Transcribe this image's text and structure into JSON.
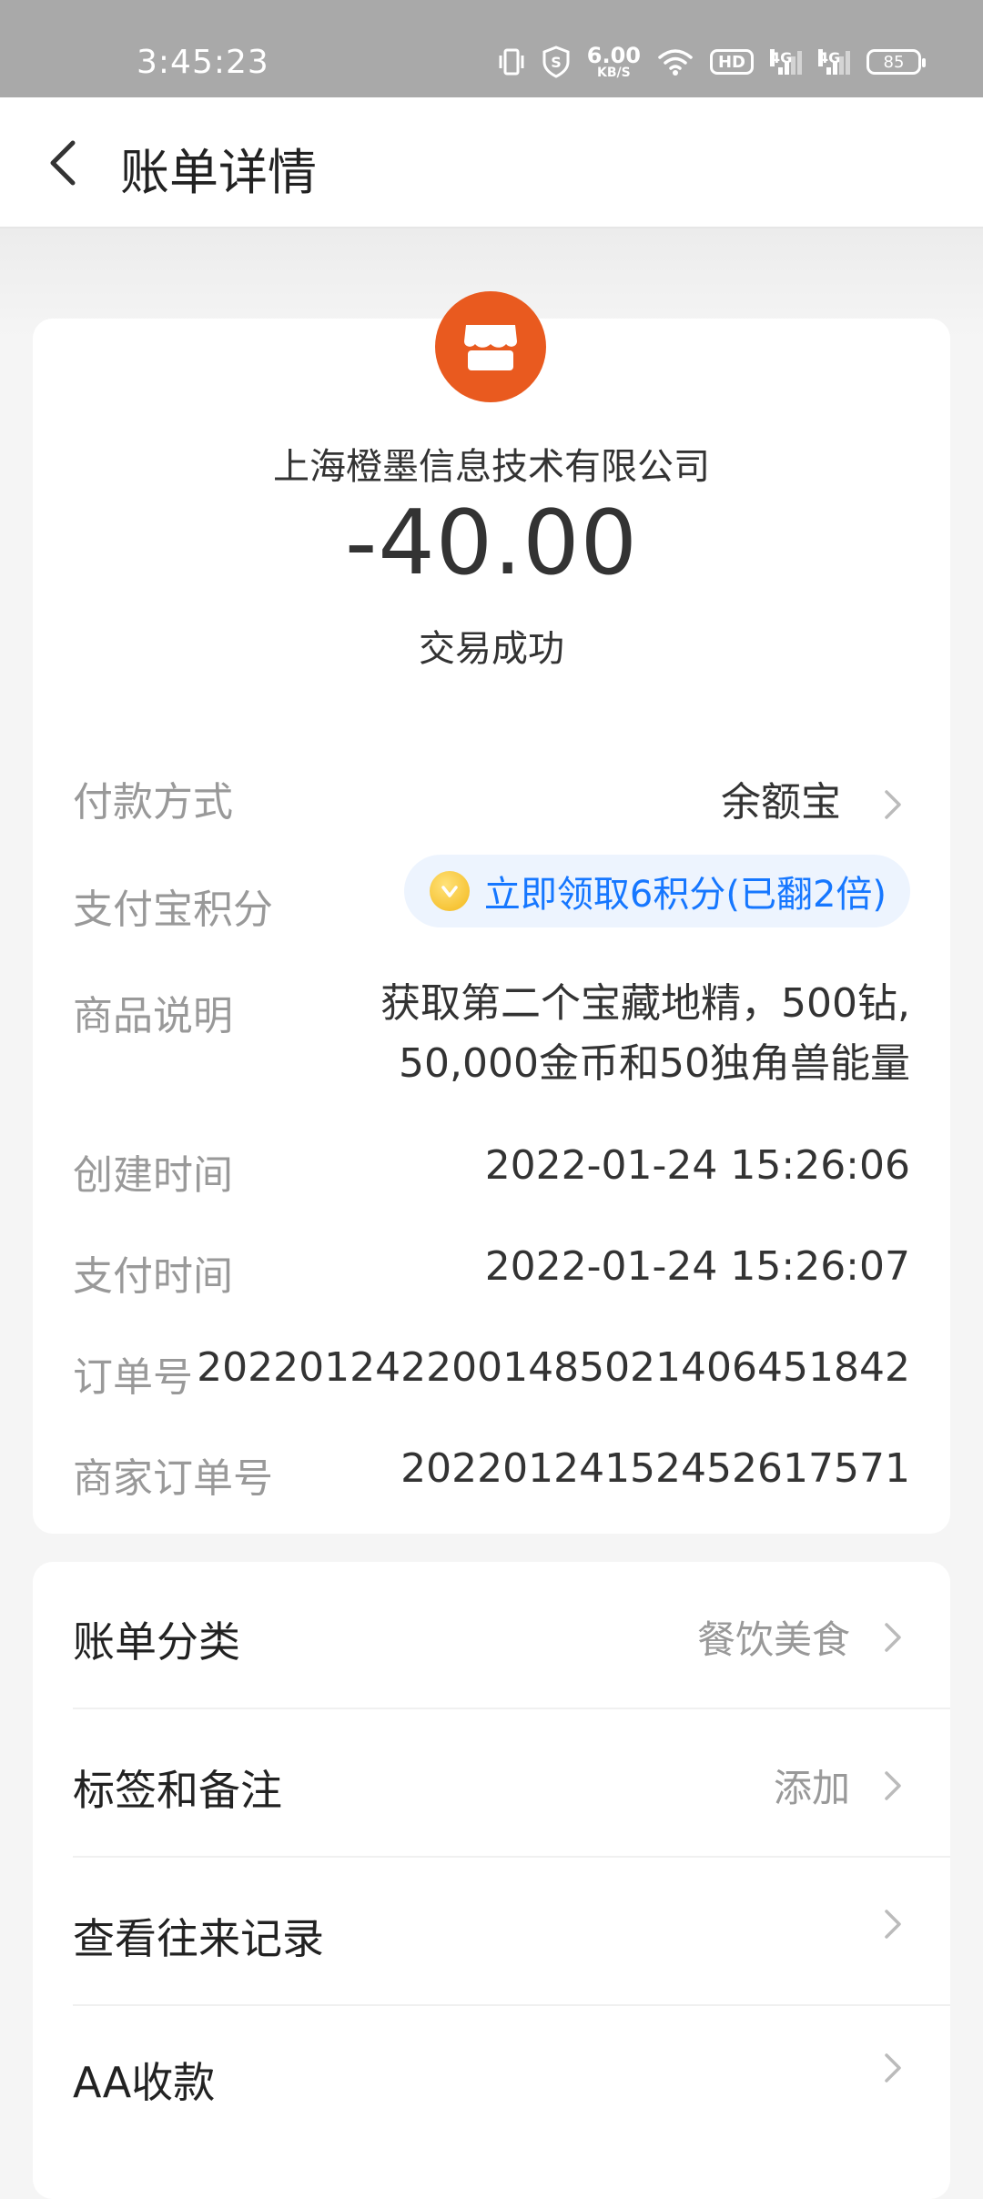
{
  "status_bar": {
    "time": "3:45:23",
    "net_speed_value": "6.00",
    "net_speed_unit": "KB/S",
    "hd_label": "HD",
    "sim1_label": "4G",
    "sim2_label": "4G",
    "battery": "85"
  },
  "header": {
    "title": "账单详情"
  },
  "transaction": {
    "merchant": "上海橙墨信息技术有限公司",
    "amount": "-40.00",
    "status": "交易成功"
  },
  "details": {
    "payment_method_label": "付款方式",
    "payment_method_value": "余额宝",
    "points_label": "支付宝积分",
    "points_value": "立即领取6积分(已翻2倍)",
    "product_desc_label": "商品说明",
    "product_desc_value": "获取第二个宝藏地精，500钻, 50,000金币和50独角兽能量",
    "created_time_label": "创建时间",
    "created_time_value": "2022-01-24 15:26:06",
    "paid_time_label": "支付时间",
    "paid_time_value": "2022-01-24 15:26:07",
    "order_no_label": "订单号",
    "order_no_value": "2022012422001485021406451842",
    "merchant_order_label": "商家订单号",
    "merchant_order_value": "2022012415245261757​1"
  },
  "actions": {
    "category_label": "账单分类",
    "category_value": "餐饮美食",
    "tags_label": "标签和备注",
    "tags_value": "添加",
    "history_label": "查看往来记录",
    "aa_label": "AA收款"
  },
  "colors": {
    "merchant_logo": "#e95a1f",
    "points_text": "#1677ff",
    "points_bg": "#edf4fe"
  }
}
